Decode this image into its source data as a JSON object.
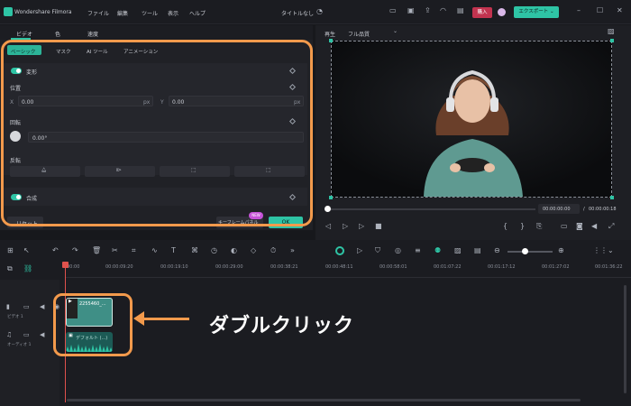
{
  "app": {
    "name": "Wondershare Filmora",
    "project_title": "タイトルなし",
    "menu": [
      "ファイル",
      "編集",
      "ツール",
      "表示",
      "ヘルプ"
    ],
    "buy_label": "購入",
    "export_label": "エクスポート"
  },
  "left_panel": {
    "main_tabs": [
      "ビデオ",
      "色",
      "速度"
    ],
    "sub_tabs": [
      "ベーシック",
      "マスク",
      "AI ツール",
      "アニメーション"
    ],
    "transform": {
      "label": "変形",
      "position_label": "位置",
      "x_label": "X",
      "x_value": "0.00",
      "x_unit": "px",
      "y_label": "Y",
      "y_value": "0.00",
      "y_unit": "px",
      "rotation_label": "回転",
      "rotation_value": "0.00°",
      "flip_label": "反転"
    },
    "composite": {
      "label": "合成"
    },
    "reset_label": "リセット",
    "keyframe_label": "キーフレームパネル",
    "keyframe_badge": "NEW",
    "ok_label": "OK"
  },
  "preview": {
    "mode_label": "再生",
    "quality_label": "フル品質",
    "current_time": "00:00:00:00",
    "separator": "/",
    "total_time": "00:00:00:18"
  },
  "timeline": {
    "ruler": [
      "00:00",
      "00:00:09:20",
      "00:00:19:10",
      "00:00:29:00",
      "00:00:38:21",
      "00:00:48:11",
      "00:00:58:01",
      "00:01:07:22",
      "00:01:17:12",
      "00:01:27:02",
      "00:01:36:22"
    ],
    "video_track_label": "ビデオ 1",
    "audio_track_label": "オーディオ 1",
    "video_clip_name": "2255460_...",
    "audio_clip_name": "デフォルト (...)"
  },
  "annotation": {
    "text": "ダブルクリック",
    "color": "#f39a4c"
  }
}
